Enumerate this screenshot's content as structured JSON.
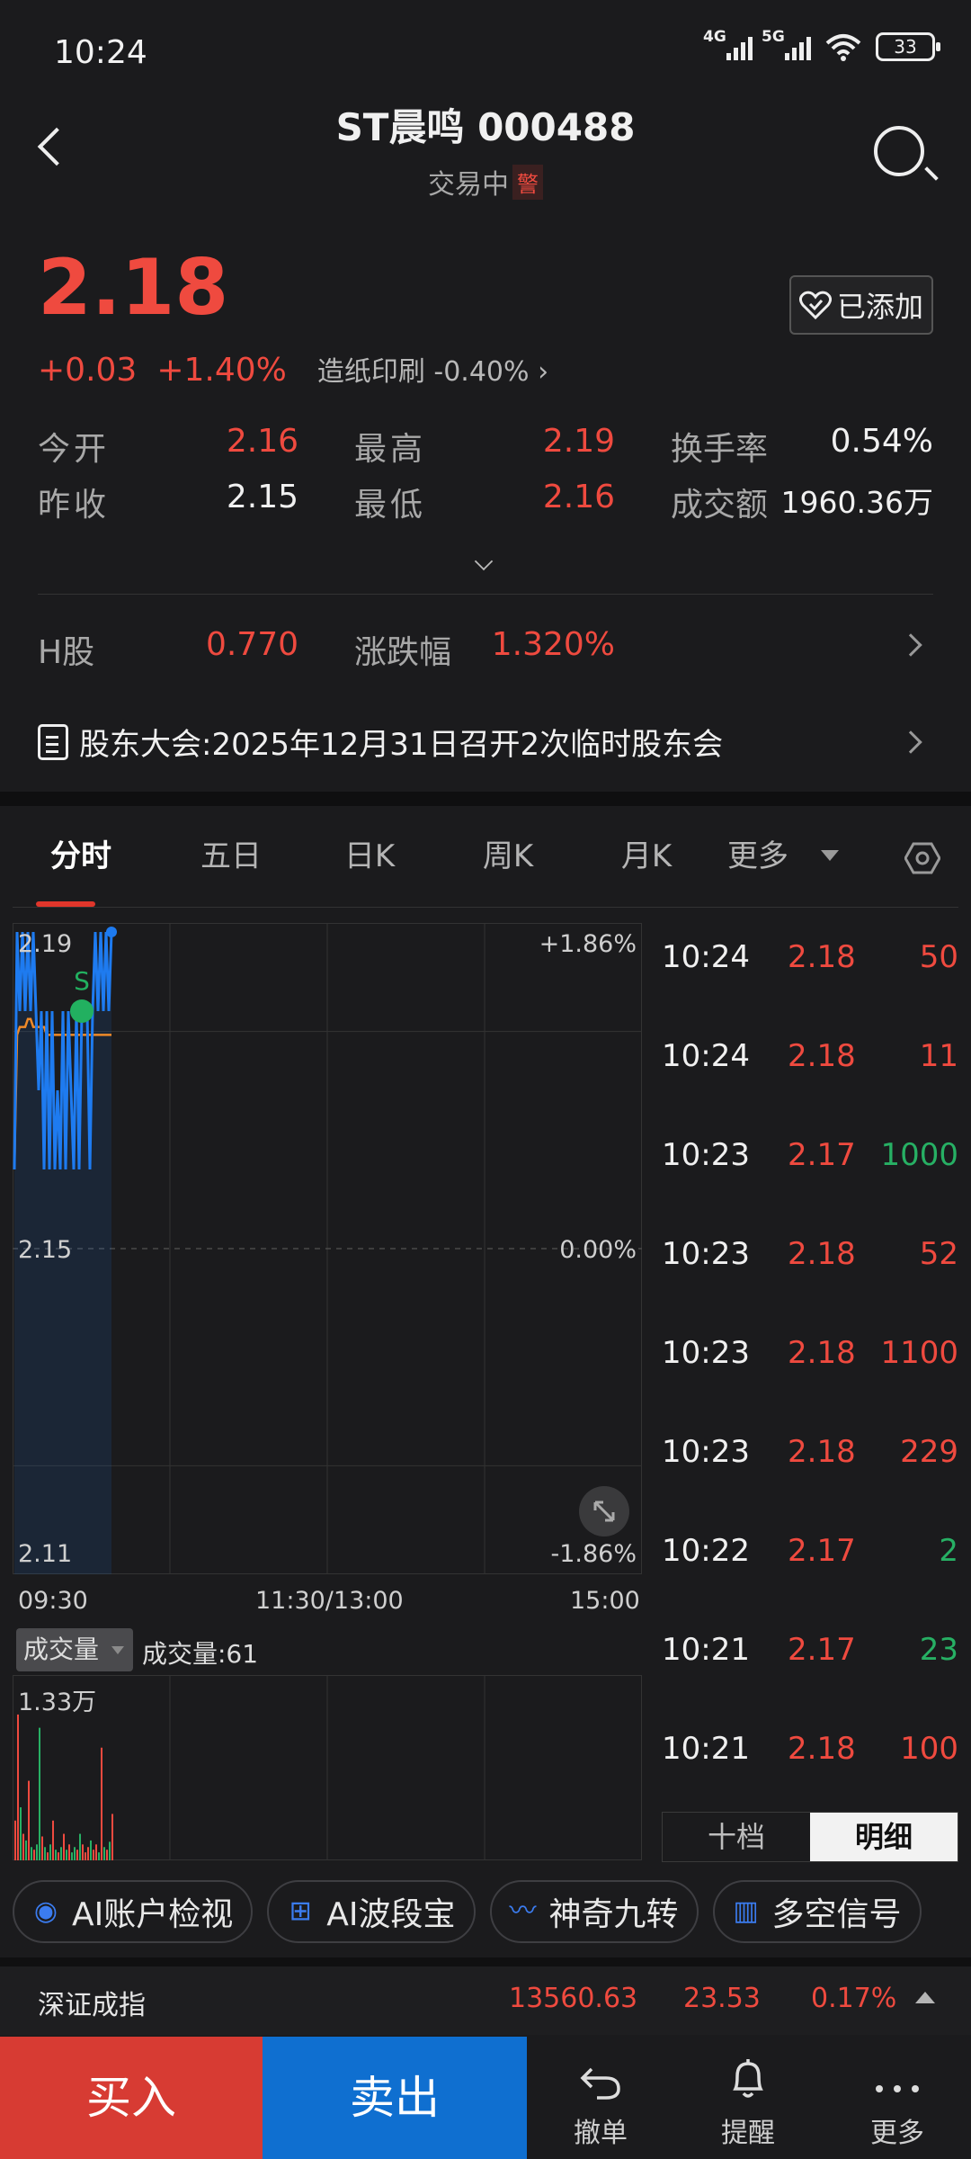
{
  "status_bar": {
    "time": "10:24",
    "net1": "4G",
    "net2": "5G",
    "battery": "33"
  },
  "header": {
    "title": "ST晨鸣 000488",
    "status": "交易中",
    "warn": "警"
  },
  "quote": {
    "price": "2.18",
    "change": "+0.03",
    "change_pct": "+1.40%",
    "sector": "造纸印刷 -0.40%",
    "added_label": "已添加",
    "open_label": "今开",
    "open": "2.16",
    "high_label": "最高",
    "high": "2.19",
    "turnover_label": "换手率",
    "turnover": "0.54%",
    "prev_label": "昨收",
    "prev": "2.15",
    "low_label": "最低",
    "low": "2.16",
    "amount_label": "成交额",
    "amount": "1960.36万"
  },
  "hshare": {
    "label": "H股",
    "value": "0.770",
    "chg_label": "涨跌幅",
    "chg": "1.320%"
  },
  "notice": "股东大会:2025年12月31日召开2次临时股东会",
  "tabs": [
    "分时",
    "五日",
    "日K",
    "周K",
    "月K",
    "更多"
  ],
  "chart": {
    "y_top": "2.19",
    "y_mid": "2.15",
    "y_bottom": "2.11",
    "pct_top": "+1.86%",
    "pct_mid": "0.00%",
    "pct_bottom": "-1.86%",
    "x_start": "09:30",
    "x_mid": "11:30/13:00",
    "x_end": "15:00",
    "marker": "S",
    "vol_button": "成交量",
    "vol_text": "成交量:61",
    "vol_max": "1.33万"
  },
  "chart_data": {
    "type": "line",
    "ylim": [
      2.11,
      2.19
    ],
    "series": [
      {
        "values": [
          2.16,
          2.19,
          2.18,
          2.19,
          2.18,
          2.19,
          2.18,
          2.19,
          2.18,
          2.17,
          2.18,
          2.16,
          2.18,
          2.16,
          2.18,
          2.16,
          2.17,
          2.16,
          2.18,
          2.16,
          2.18,
          2.17,
          2.16,
          2.18,
          2.16,
          2.18,
          2.18,
          2.18,
          2.16,
          2.18,
          2.19,
          2.18,
          2.19,
          2.18,
          2.19,
          2.18,
          2.19
        ]
      },
      {
        "values": [
          2.16,
          2.177,
          2.178,
          2.178,
          2.178,
          2.179,
          2.179,
          2.178,
          2.178,
          2.178,
          2.178,
          2.178,
          2.177,
          2.177,
          2.177,
          2.177,
          2.177,
          2.177,
          2.177,
          2.177,
          2.177,
          2.177,
          2.177,
          2.177,
          2.177,
          2.177,
          2.177,
          2.177,
          2.177,
          2.177,
          2.177,
          2.177,
          2.177,
          2.177,
          2.177,
          2.177,
          2.177
        ]
      }
    ],
    "volume": [
      30,
      110,
      40,
      20,
      15,
      60,
      10,
      8,
      12,
      100,
      18,
      10,
      6,
      12,
      30,
      8,
      6,
      10,
      20,
      8,
      12,
      6,
      10,
      8,
      20,
      12,
      6,
      10,
      15,
      8,
      12,
      6,
      85,
      10,
      8,
      14,
      35
    ]
  },
  "ticks": [
    {
      "time": "10:24",
      "price": "2.18",
      "vol": "50",
      "pc": "red",
      "vc": "red"
    },
    {
      "time": "10:24",
      "price": "2.18",
      "vol": "11",
      "pc": "red",
      "vc": "red"
    },
    {
      "time": "10:23",
      "price": "2.17",
      "vol": "1000",
      "pc": "red",
      "vc": "green"
    },
    {
      "time": "10:23",
      "price": "2.18",
      "vol": "52",
      "pc": "red",
      "vc": "red"
    },
    {
      "time": "10:23",
      "price": "2.18",
      "vol": "1100",
      "pc": "red",
      "vc": "red"
    },
    {
      "time": "10:23",
      "price": "2.18",
      "vol": "229",
      "pc": "red",
      "vc": "red"
    },
    {
      "time": "10:22",
      "price": "2.17",
      "vol": "2",
      "pc": "red",
      "vc": "green"
    },
    {
      "time": "10:21",
      "price": "2.17",
      "vol": "23",
      "pc": "red",
      "vc": "green"
    },
    {
      "time": "10:21",
      "price": "2.18",
      "vol": "100",
      "pc": "red",
      "vc": "red"
    }
  ],
  "detail_tabs": {
    "ten": "十档",
    "detail": "明细"
  },
  "chips": [
    "AI账户检视",
    "AI波段宝",
    "神奇九转",
    "多空信号"
  ],
  "index": {
    "name": "深证成指",
    "value": "13560.63",
    "change": "23.53",
    "pct": "0.17%"
  },
  "bottom": {
    "buy": "买入",
    "sell": "卖出",
    "cancel": "撤单",
    "alert": "提醒",
    "more": "更多"
  },
  "colors": {
    "up": "#ef4a3f",
    "down": "#27b064",
    "line": "#1e7bf0",
    "avg": "#f08a28",
    "buy": "#d73b33",
    "sell": "#0f6fd0"
  }
}
